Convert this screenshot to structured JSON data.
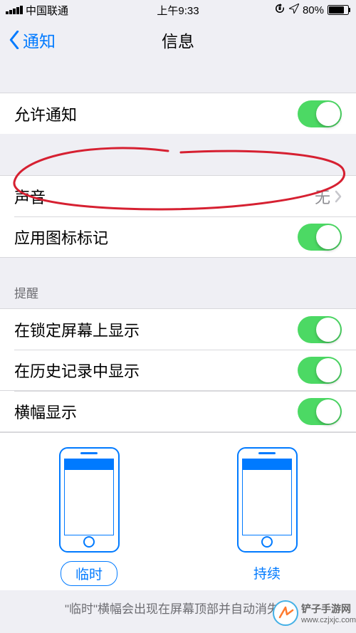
{
  "statusbar": {
    "carrier": "中国联通",
    "time": "上午9:33",
    "battery_pct": 80,
    "battery_text": "80%"
  },
  "navbar": {
    "back": "通知",
    "title": "信息"
  },
  "groups": {
    "allow_notifications": "允许通知",
    "sound_label": "声音",
    "sound_value": "无",
    "badge": "应用图标标记"
  },
  "alerts_header": "提醒",
  "alerts": {
    "lock_screen": "在锁定屏幕上显示",
    "history": "在历史记录中显示",
    "banner": "横幅显示"
  },
  "banner_style": {
    "temporary": "临时",
    "persistent": "持续"
  },
  "footer": "\"临时\"横幅会出现在屏幕顶部并自动消失。",
  "watermark": {
    "site": "铲子手游网",
    "url": "www.czjxjc.com"
  }
}
